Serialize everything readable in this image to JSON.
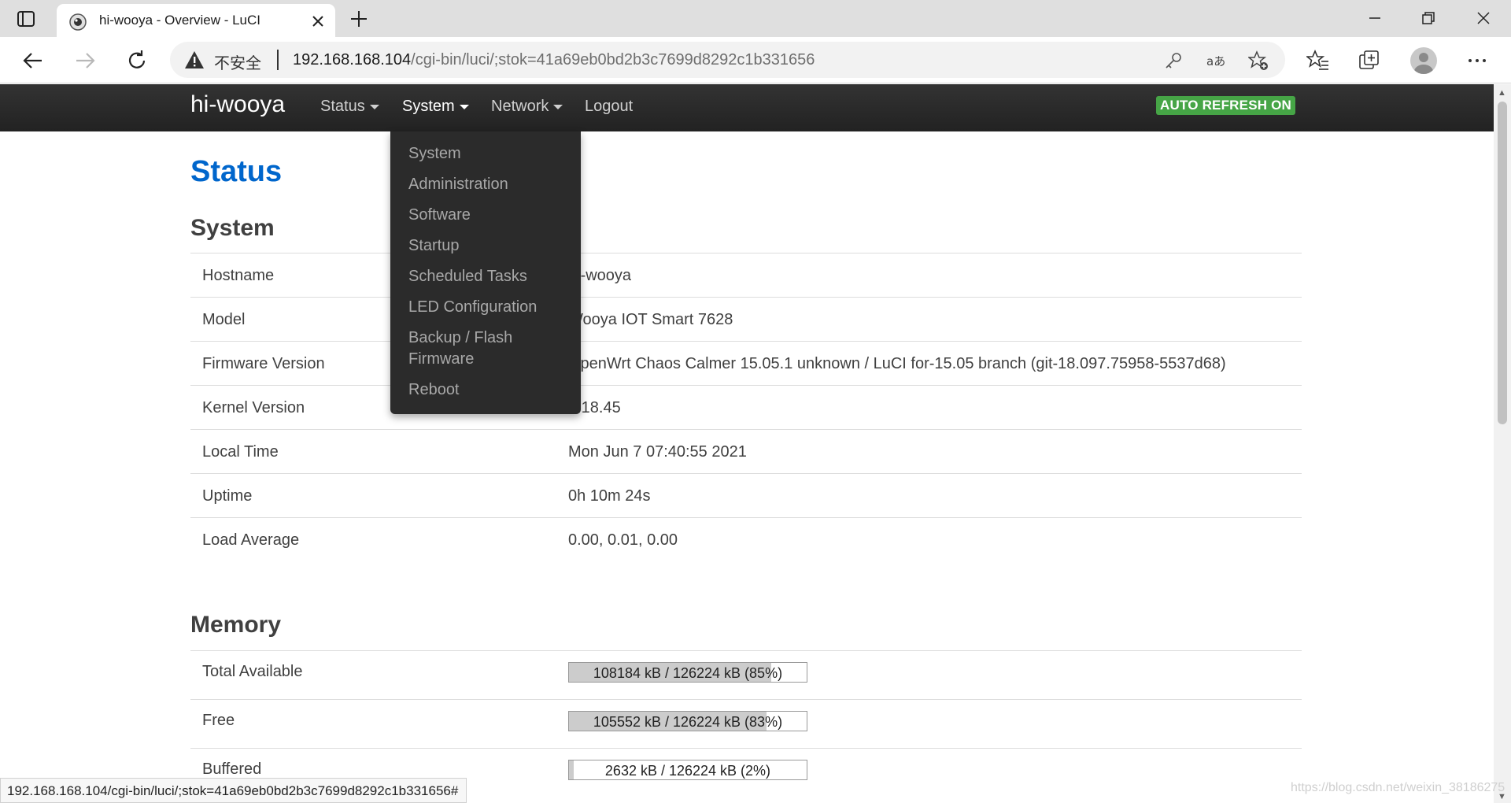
{
  "browser": {
    "tab_title": "hi-wooya - Overview - LuCI",
    "security_label": "不安全",
    "url_host": "192.168.168.104",
    "url_path": "/cgi-bin/luci/;stok=41a69eb0bd2b3c7699d8292c1b331656",
    "status_bar_url": "192.168.168.104/cgi-bin/luci/;stok=41a69eb0bd2b3c7699d8292c1b331656#"
  },
  "navbar": {
    "brand": "hi-wooya",
    "menu": [
      {
        "label": "Status"
      },
      {
        "label": "System"
      },
      {
        "label": "Network"
      },
      {
        "label": "Logout"
      }
    ],
    "auto_refresh": "AUTO REFRESH ON"
  },
  "dropdown": {
    "items": [
      {
        "label": "System"
      },
      {
        "label": "Administration"
      },
      {
        "label": "Software"
      },
      {
        "label": "Startup"
      },
      {
        "label": "Scheduled Tasks"
      },
      {
        "label": "LED Configuration"
      },
      {
        "label": "Backup / Flash Firmware"
      },
      {
        "label": "Reboot"
      }
    ]
  },
  "page": {
    "title": "Status",
    "system_heading": "System",
    "system_rows": [
      {
        "label": "Hostname",
        "value": "hi-wooya"
      },
      {
        "label": "Model",
        "value": "Wooya IOT Smart 7628"
      },
      {
        "label": "Firmware Version",
        "value": "OpenWrt Chaos Calmer 15.05.1 unknown / LuCI for-15.05 branch (git-18.097.75958-5537d68)"
      },
      {
        "label": "Kernel Version",
        "value": "3.18.45"
      },
      {
        "label": "Local Time",
        "value": "Mon Jun 7 07:40:55 2021"
      },
      {
        "label": "Uptime",
        "value": "0h 10m 24s"
      },
      {
        "label": "Load Average",
        "value": "0.00, 0.01, 0.00"
      }
    ],
    "memory_heading": "Memory",
    "memory_rows": [
      {
        "label": "Total Available",
        "text": "108184 kB / 126224 kB (85%)",
        "fraction": 0.85
      },
      {
        "label": "Free",
        "text": "105552 kB / 126224 kB (83%)",
        "fraction": 0.83
      },
      {
        "label": "Buffered",
        "text": "2632 kB / 126224 kB (2%)",
        "fraction": 0.02
      }
    ]
  },
  "watermark": "https://blog.csdn.net/weixin_38186275",
  "colors": {
    "accent_title": "#0066cc",
    "auto_refresh_bg": "#46a546",
    "navbar_bg": "#222222",
    "dropdown_bg": "#2b2b2b"
  }
}
